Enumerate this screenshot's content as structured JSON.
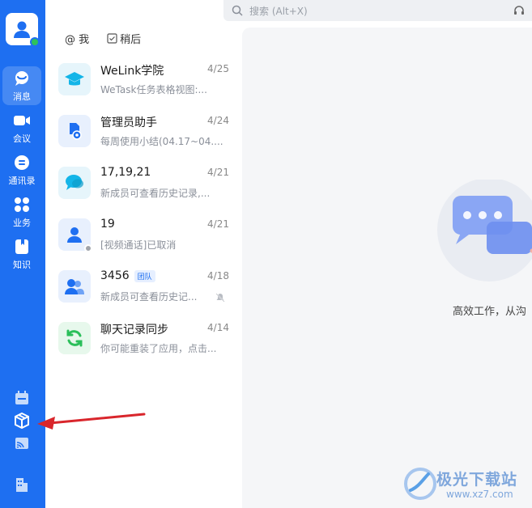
{
  "search": {
    "placeholder": "搜索 (Alt+X)"
  },
  "nav": {
    "items": [
      {
        "label": "消息",
        "icon": "chat-bubble-icon"
      },
      {
        "label": "会议",
        "icon": "video-camera-icon"
      },
      {
        "label": "通讯录",
        "icon": "contacts-icon"
      },
      {
        "label": "业务",
        "icon": "apps-grid-icon"
      },
      {
        "label": "知识",
        "icon": "bookmark-icon"
      }
    ],
    "bottom_icons": [
      "calendar-icon",
      "cube-box-icon",
      "cast-icon",
      "building-icon"
    ]
  },
  "filters": [
    {
      "label": "@ 我",
      "icon": "at-icon"
    },
    {
      "label": "稍后",
      "icon": "checkbox-icon"
    }
  ],
  "conversations": [
    {
      "name": "WeLink学院",
      "date": "4/25",
      "preview": "WeTask任务表格视图:...",
      "avatar_icon": "graduation-cap-icon"
    },
    {
      "name": "管理员助手",
      "date": "4/24",
      "preview": "每周使用小结(04.17~04....",
      "avatar_icon": "admin-doc-icon"
    },
    {
      "name": "17,19,21",
      "date": "4/21",
      "preview": "新成员可查看历史记录,...",
      "avatar_icon": "group-chat-icon"
    },
    {
      "name": "19",
      "date": "4/21",
      "preview": "[视频通话]已取消",
      "avatar_icon": "user-icon"
    },
    {
      "name": "3456",
      "tag": "团队",
      "date": "4/18",
      "preview": "新成员可查看历史记...",
      "avatar_icon": "team-icon"
    },
    {
      "name": "聊天记录同步",
      "date": "4/14",
      "preview": "你可能重装了应用，点击...",
      "avatar_icon": "sync-icon"
    }
  ],
  "main": {
    "slogan": "高效工作，从沟"
  },
  "watermark": {
    "text": "极光下载站",
    "url": "www.xz7.com"
  },
  "colors": {
    "brand": "#1e6ff1",
    "annotation_arrow": "#d9262c"
  }
}
